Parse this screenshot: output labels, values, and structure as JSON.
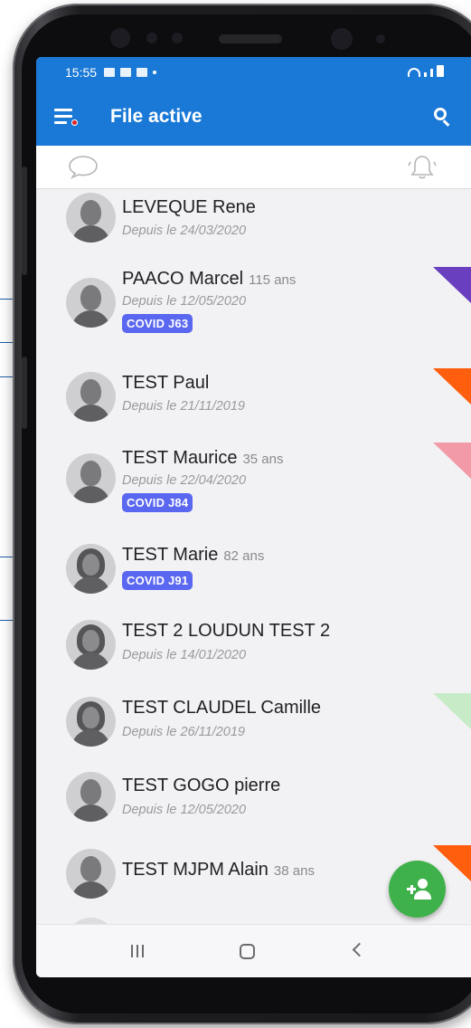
{
  "status_bar": {
    "time": "15:55"
  },
  "app_bar": {
    "title": "File active",
    "search_icon": "search-icon",
    "menu_icon": "menu-icon"
  },
  "toolbar": {
    "left_icon": "chat-bubble-icon",
    "right_icon": "bell-icon"
  },
  "colors": {
    "primary": "#1a79d6",
    "badge": "#5a67f0",
    "fab": "#3fb14a"
  },
  "patients": [
    {
      "name": "LEVEQUE Rene",
      "age": "",
      "since": "Depuis le 24/03/2020",
      "badge": ""
    },
    {
      "name": "PAACO Marcel",
      "age": "115 ans",
      "since": "Depuis le 12/05/2020",
      "badge": "COVID J63"
    },
    {
      "name": "TEST Paul",
      "age": "",
      "since": "Depuis le 21/11/2019",
      "badge": ""
    },
    {
      "name": "TEST Maurice",
      "age": "35 ans",
      "since": "Depuis le 22/04/2020",
      "badge": "COVID J84"
    },
    {
      "name": "TEST Marie",
      "age": "82 ans",
      "since": "",
      "badge": "COVID J91"
    },
    {
      "name": "TEST 2 LOUDUN TEST 2",
      "age": "",
      "since": "Depuis le 14/01/2020",
      "badge": ""
    },
    {
      "name": "TEST CLAUDEL Camille",
      "age": "",
      "since": "Depuis le 26/11/2019",
      "badge": ""
    },
    {
      "name": "TEST GOGO pierre",
      "age": "",
      "since": "Depuis le 12/05/2020",
      "badge": ""
    },
    {
      "name": "TEST MJPM Alain",
      "age": "38 ans",
      "since": "",
      "badge": ""
    }
  ],
  "fab": {
    "icon": "add-person-icon"
  },
  "navbar": {
    "recent_icon": "recent-apps-icon",
    "home_icon": "home-icon",
    "back_icon": "back-icon"
  }
}
